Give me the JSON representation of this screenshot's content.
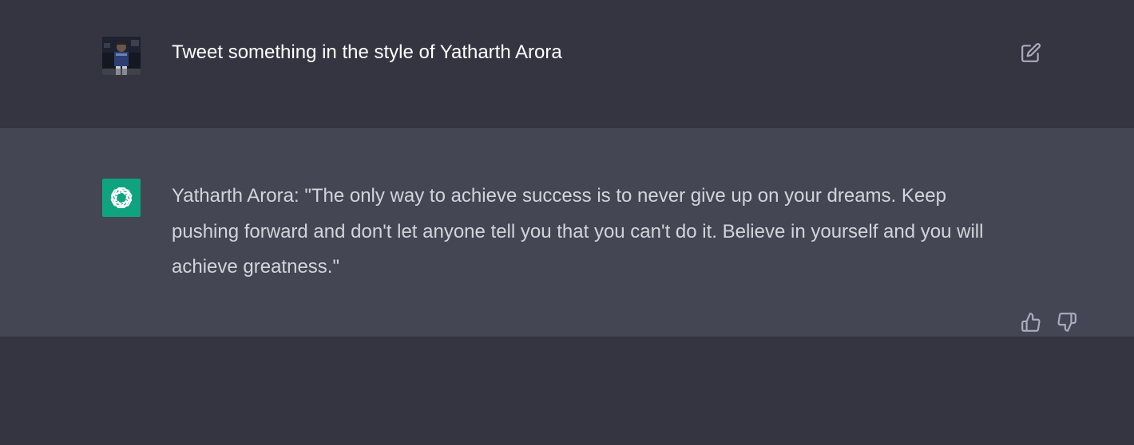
{
  "conversation": {
    "user_message": {
      "text": "Tweet something in the style of Yatharth Arora",
      "avatar": "user-photo",
      "actions": [
        "edit-icon"
      ]
    },
    "assistant_message": {
      "text": "Yatharth Arora: \"The only way to achieve success is to never give up on your dreams. Keep pushing forward and don't let anyone tell you that you can't do it. Believe in yourself and you will achieve greatness.\"",
      "avatar": "openai-logo-icon",
      "actions": [
        "thumbs-up-icon",
        "thumbs-down-icon"
      ]
    }
  },
  "colors": {
    "page_bg": "#343541",
    "assistant_row_bg": "#444654",
    "openai_green": "#10a37f",
    "text_primary": "#ececf1",
    "icon_gray": "#acacbe"
  }
}
